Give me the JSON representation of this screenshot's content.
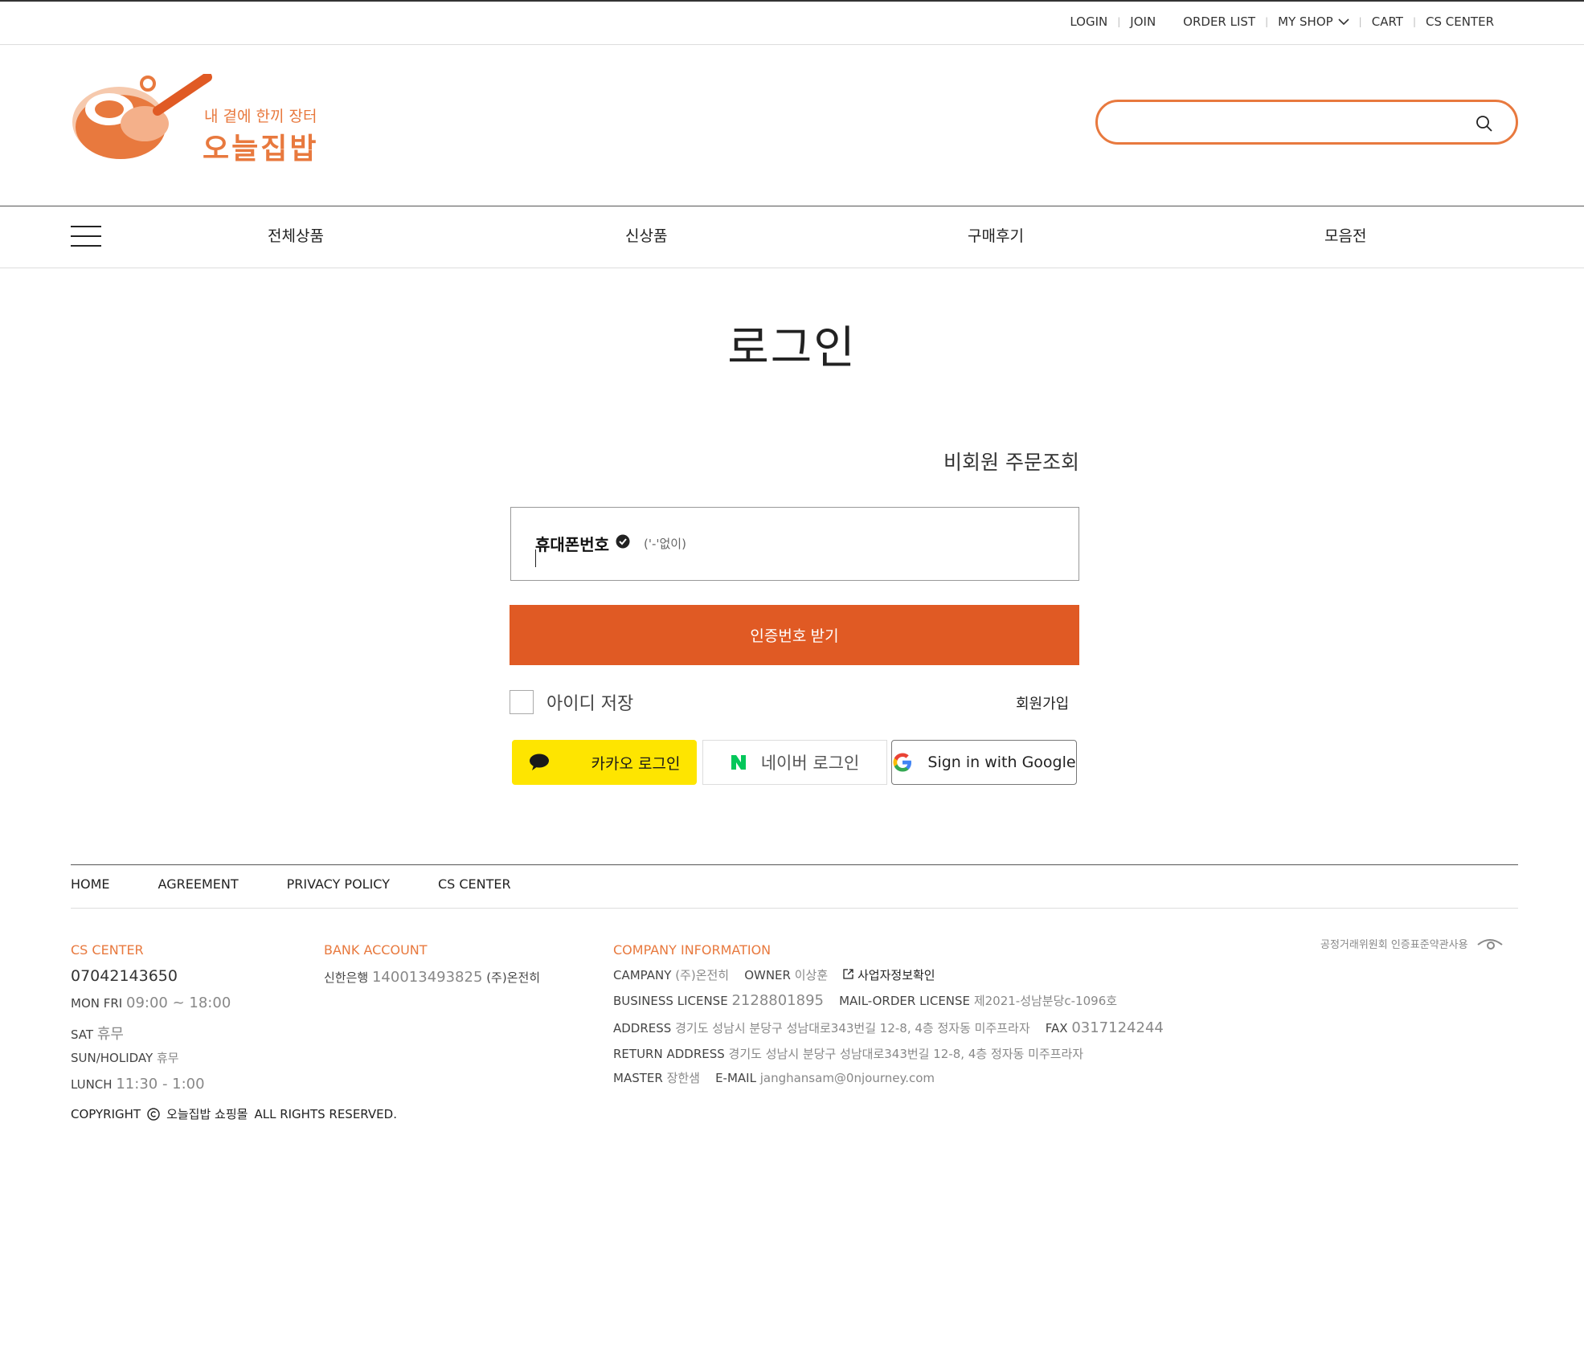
{
  "topnav": {
    "login": "LOGIN",
    "join": "JOIN",
    "order_list": "ORDER LIST",
    "my_shop": "MY SHOP",
    "cart": "CART",
    "cs_center": "CS CENTER"
  },
  "logo": {
    "tagline": "내 곁에 한끼 장터",
    "brand": "오늘집밥"
  },
  "search": {
    "placeholder": ""
  },
  "categories": [
    "전체상품",
    "신상품",
    "구매후기",
    "모음전"
  ],
  "login": {
    "title": "로그인",
    "guest_link": "비회원 주문조회",
    "phone_label": "휴대폰번호",
    "phone_hint": "('-'없이)",
    "cta": "인증번호 받기",
    "remember": "아이디 저장",
    "join": "회원가입",
    "kakao": "카카오 로그인",
    "naver": "네이버 로그인",
    "google": "Sign in with Google"
  },
  "footer": {
    "nav": [
      "HOME",
      "AGREEMENT",
      "PRIVACY POLICY",
      "CS CENTER"
    ],
    "cs": {
      "title": "CS CENTER",
      "phone": "07042143650",
      "weekday_label": "MON FRI",
      "weekday_hours": "09:00 ~ 18:00",
      "sat_label": "SAT",
      "sat_value": "휴무",
      "holiday_label": "SUN/HOLIDAY",
      "holiday_value": "휴무",
      "lunch_label": "LUNCH",
      "lunch_value": "11:30 - 1:00"
    },
    "bank": {
      "title": "BANK ACCOUNT",
      "bank_name": "신한은행",
      "account": "140013493825",
      "holder": "(주)온전히"
    },
    "company": {
      "title": "COMPANY INFORMATION",
      "campany_label": "CAMPANY",
      "campany_value": "(주)온전히",
      "owner_label": "OWNER",
      "owner_value": "이상훈",
      "biz_check": "사업자정보확인",
      "license_label": "BUSINESS LICENSE",
      "license_value": "2128801895",
      "mail_label": "MAIL-ORDER LICENSE",
      "mail_value": "제2021-성남분당c-1096호",
      "address_label": "ADDRESS",
      "address_value": "경기도 성남시 분당구 성남대로343번길 12-8, 4층 정자동 미주프라자",
      "fax_label": "FAX",
      "fax_value": "0317124244",
      "return_label": "RETURN ADDRESS",
      "return_value": "경기도 성남시 분당구 성남대로343번길 12-8, 4층 정자동 미주프라자",
      "master_label": "MASTER",
      "master_value": "장한샘",
      "email_label": "E-MAIL",
      "email_value": "janghansam@0njourney.com"
    },
    "copyright_pre": "COPYRIGHT",
    "copyright_name": "오늘집밥 쇼핑몰",
    "copyright_post": "ALL RIGHTS RESERVED.",
    "ftc": "공정거래위원회 인증표준약관사용"
  },
  "colors": {
    "accent": "#e8793e",
    "cta": "#e05a24",
    "kakao": "#fee500",
    "naver": "#03c75a"
  }
}
